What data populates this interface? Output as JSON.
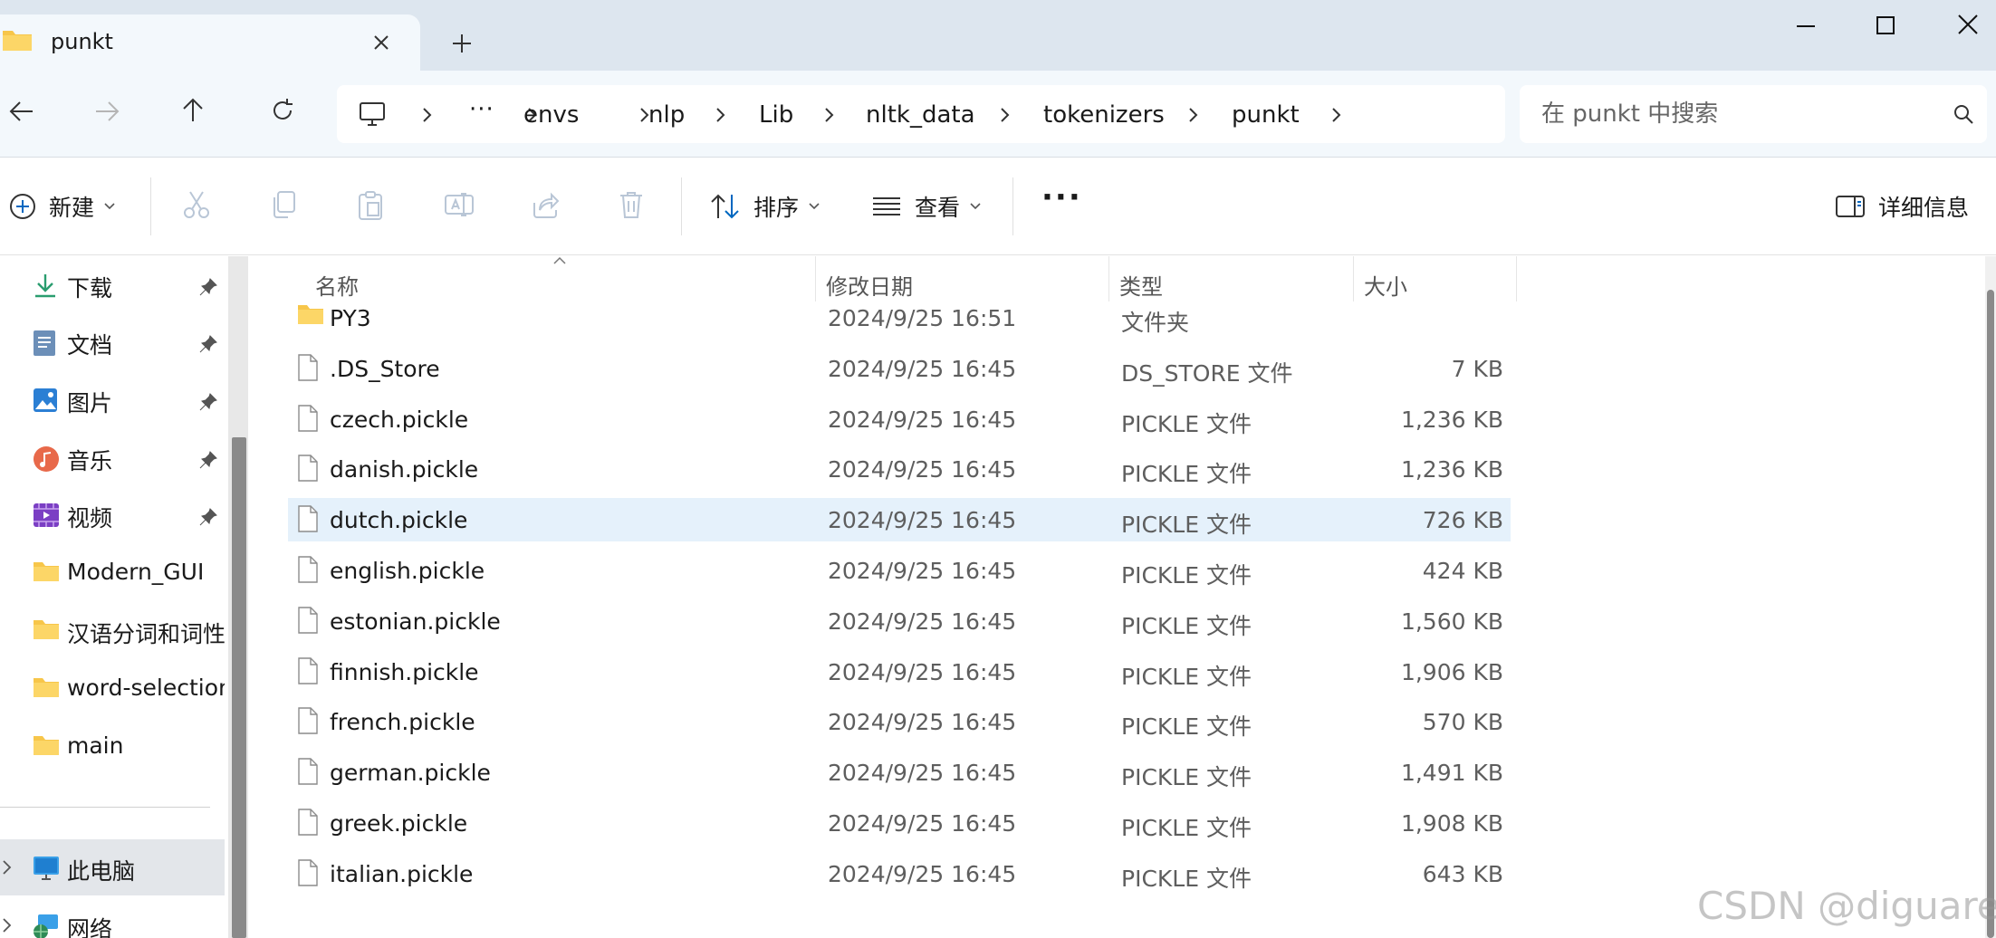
{
  "tab": {
    "title": "punkt"
  },
  "address": {
    "more": "···",
    "crumbs": [
      "envs",
      "nlp",
      "Lib",
      "nltk_data",
      "tokenizers",
      "punkt"
    ]
  },
  "search": {
    "placeholder": "在 punkt 中搜索"
  },
  "commands": {
    "new_label": "新建",
    "sort_label": "排序",
    "view_label": "查看",
    "more_label": "···",
    "details_label": "详细信息"
  },
  "sidebar": {
    "items": [
      {
        "label": "下载",
        "icon": "download-icon",
        "pinned": true
      },
      {
        "label": "文档",
        "icon": "documents-icon",
        "pinned": true
      },
      {
        "label": "图片",
        "icon": "pictures-icon",
        "pinned": true
      },
      {
        "label": "音乐",
        "icon": "music-icon",
        "pinned": true
      },
      {
        "label": "视频",
        "icon": "videos-icon",
        "pinned": true
      },
      {
        "label": "Modern_GUI",
        "icon": "folder-icon",
        "pinned": false
      },
      {
        "label": "汉语分词和词性标注",
        "icon": "folder-icon",
        "pinned": false
      },
      {
        "label": "word-selection",
        "icon": "folder-icon",
        "pinned": false
      },
      {
        "label": "main",
        "icon": "folder-icon",
        "pinned": false
      }
    ],
    "this_pc": "此电脑",
    "network": "网络"
  },
  "columns": {
    "name": "名称",
    "modified": "修改日期",
    "type": "类型",
    "size": "大小"
  },
  "files": [
    {
      "name": "PY3",
      "modified": "2024/9/25 16:51",
      "type": "文件夹",
      "size": "",
      "kind": "folder"
    },
    {
      "name": ".DS_Store",
      "modified": "2024/9/25 16:45",
      "type": "DS_STORE 文件",
      "size": "7 KB",
      "kind": "file"
    },
    {
      "name": "czech.pickle",
      "modified": "2024/9/25 16:45",
      "type": "PICKLE 文件",
      "size": "1,236 KB",
      "kind": "file"
    },
    {
      "name": "danish.pickle",
      "modified": "2024/9/25 16:45",
      "type": "PICKLE 文件",
      "size": "1,236 KB",
      "kind": "file"
    },
    {
      "name": "dutch.pickle",
      "modified": "2024/9/25 16:45",
      "type": "PICKLE 文件",
      "size": "726 KB",
      "kind": "file",
      "selected": true
    },
    {
      "name": "english.pickle",
      "modified": "2024/9/25 16:45",
      "type": "PICKLE 文件",
      "size": "424 KB",
      "kind": "file"
    },
    {
      "name": "estonian.pickle",
      "modified": "2024/9/25 16:45",
      "type": "PICKLE 文件",
      "size": "1,560 KB",
      "kind": "file"
    },
    {
      "name": "finnish.pickle",
      "modified": "2024/9/25 16:45",
      "type": "PICKLE 文件",
      "size": "1,906 KB",
      "kind": "file"
    },
    {
      "name": "french.pickle",
      "modified": "2024/9/25 16:45",
      "type": "PICKLE 文件",
      "size": "570 KB",
      "kind": "file"
    },
    {
      "name": "german.pickle",
      "modified": "2024/9/25 16:45",
      "type": "PICKLE 文件",
      "size": "1,491 KB",
      "kind": "file"
    },
    {
      "name": "greek.pickle",
      "modified": "2024/9/25 16:45",
      "type": "PICKLE 文件",
      "size": "1,908 KB",
      "kind": "file"
    },
    {
      "name": "italian.pickle",
      "modified": "2024/9/25 16:45",
      "type": "PICKLE 文件",
      "size": "643 KB",
      "kind": "file"
    }
  ],
  "watermark": "CSDN @diguaren",
  "colors": {
    "accent": "#0067c0",
    "selection": "#e5f1fb",
    "folder": "#f7c64a",
    "tabbar": "#dde6ef"
  }
}
